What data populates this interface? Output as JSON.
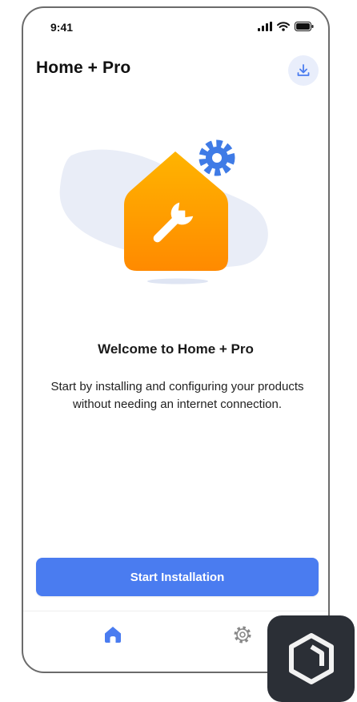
{
  "status_bar": {
    "time": "9:41",
    "icons": [
      "signal-icon",
      "wifi-icon",
      "battery-icon"
    ]
  },
  "header": {
    "title": "Home + Pro",
    "download_icon": "download-icon"
  },
  "illustration": {
    "icons": [
      "house-icon",
      "wrench-icon",
      "gear-icon"
    ]
  },
  "welcome": {
    "title": "Welcome to Home + Pro",
    "body": "Start by installing and configuring your products without needing an internet connection."
  },
  "primary_action": {
    "label": "Start Installation"
  },
  "tab_bar": {
    "tabs": [
      {
        "icon": "home-icon",
        "active": true
      },
      {
        "icon": "settings-icon",
        "active": false
      }
    ]
  },
  "colors": {
    "accent": "#4a7cf0",
    "house_top": "#ffb400",
    "house_bottom": "#ff8a00",
    "gear": "#3f7be6",
    "blob": "#e9edf7"
  }
}
